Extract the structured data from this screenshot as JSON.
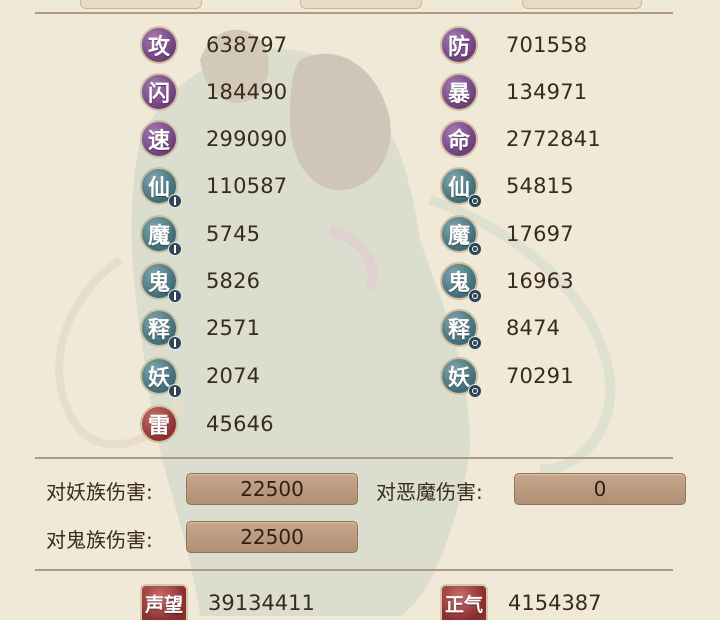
{
  "colors": {
    "background": "#f1e9d8",
    "attack_badge": "#6e3f7b",
    "element_badge": "#3f6c77",
    "thunder_badge": "#8c3131",
    "value_text": "#3a2a1e",
    "damage_box": "#b08f73"
  },
  "stats": {
    "left": [
      {
        "glyph": "攻",
        "value": "638797",
        "style": "purple",
        "badge": ""
      },
      {
        "glyph": "闪",
        "value": "184490",
        "style": "purple",
        "badge": ""
      },
      {
        "glyph": "速",
        "value": "299090",
        "style": "purple",
        "badge": ""
      },
      {
        "glyph": "仙",
        "value": "110587",
        "style": "teal",
        "badge": "bar"
      },
      {
        "glyph": "魔",
        "value": "5745",
        "style": "teal",
        "badge": "bar"
      },
      {
        "glyph": "鬼",
        "value": "5826",
        "style": "teal",
        "badge": "bar"
      },
      {
        "glyph": "释",
        "value": "2571",
        "style": "teal",
        "badge": "bar"
      },
      {
        "glyph": "妖",
        "value": "2074",
        "style": "teal",
        "badge": "bar"
      },
      {
        "glyph": "雷",
        "value": "45646",
        "style": "red",
        "badge": ""
      }
    ],
    "right": [
      {
        "glyph": "防",
        "value": "701558",
        "style": "purple",
        "badge": ""
      },
      {
        "glyph": "暴",
        "value": "134971",
        "style": "purple",
        "badge": ""
      },
      {
        "glyph": "命",
        "value": "2772841",
        "style": "purple",
        "badge": ""
      },
      {
        "glyph": "仙",
        "value": "54815",
        "style": "teal",
        "badge": "ring"
      },
      {
        "glyph": "魔",
        "value": "17697",
        "style": "teal",
        "badge": "ring"
      },
      {
        "glyph": "鬼",
        "value": "16963",
        "style": "teal",
        "badge": "ring"
      },
      {
        "glyph": "释",
        "value": "8474",
        "style": "teal",
        "badge": "ring"
      },
      {
        "glyph": "妖",
        "value": "70291",
        "style": "teal",
        "badge": "ring"
      }
    ]
  },
  "damage": {
    "vs_demon_label": "对妖族伤害:",
    "vs_demon_value": "22500",
    "vs_evil_label": "对恶魔伤害:",
    "vs_evil_value": "0",
    "vs_ghost_label": "对鬼族伤害:",
    "vs_ghost_value": "22500"
  },
  "bottom": {
    "reputation_glyph": "声望",
    "reputation_value": "39134411",
    "righteous_glyph": "正气",
    "righteous_value": "4154387"
  }
}
